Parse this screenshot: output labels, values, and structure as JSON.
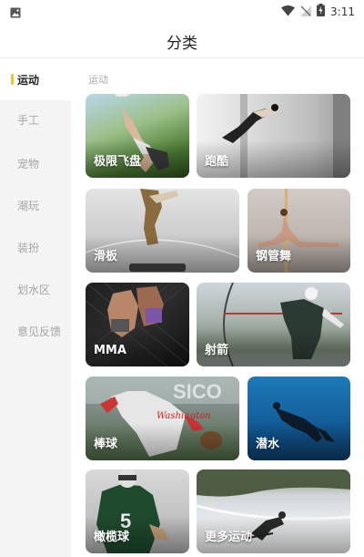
{
  "status_bar": {
    "time": "3:11",
    "left_icon": "image-icon",
    "right_icons": [
      "wifi-icon",
      "no-signal-icon",
      "battery-charging-icon"
    ]
  },
  "header": {
    "title": "分类"
  },
  "sidebar": {
    "items": [
      {
        "label": "运动",
        "active": true
      },
      {
        "label": "手工",
        "active": false
      },
      {
        "label": "宠物",
        "active": false
      },
      {
        "label": "潮玩",
        "active": false
      },
      {
        "label": "装扮",
        "active": false
      },
      {
        "label": "划水区",
        "active": false
      },
      {
        "label": "意见反馈",
        "active": false
      }
    ],
    "accent_color": "#f2c230"
  },
  "main": {
    "section_title": "运动",
    "cards": [
      {
        "label": "极限飞盘"
      },
      {
        "label": "跑酷"
      },
      {
        "label": "滑板"
      },
      {
        "label": "钢管舞"
      },
      {
        "label": "MMA"
      },
      {
        "label": "射箭"
      },
      {
        "label": "棒球"
      },
      {
        "label": "潜水"
      },
      {
        "label": "橄榄球"
      },
      {
        "label": "更多运动"
      }
    ]
  }
}
